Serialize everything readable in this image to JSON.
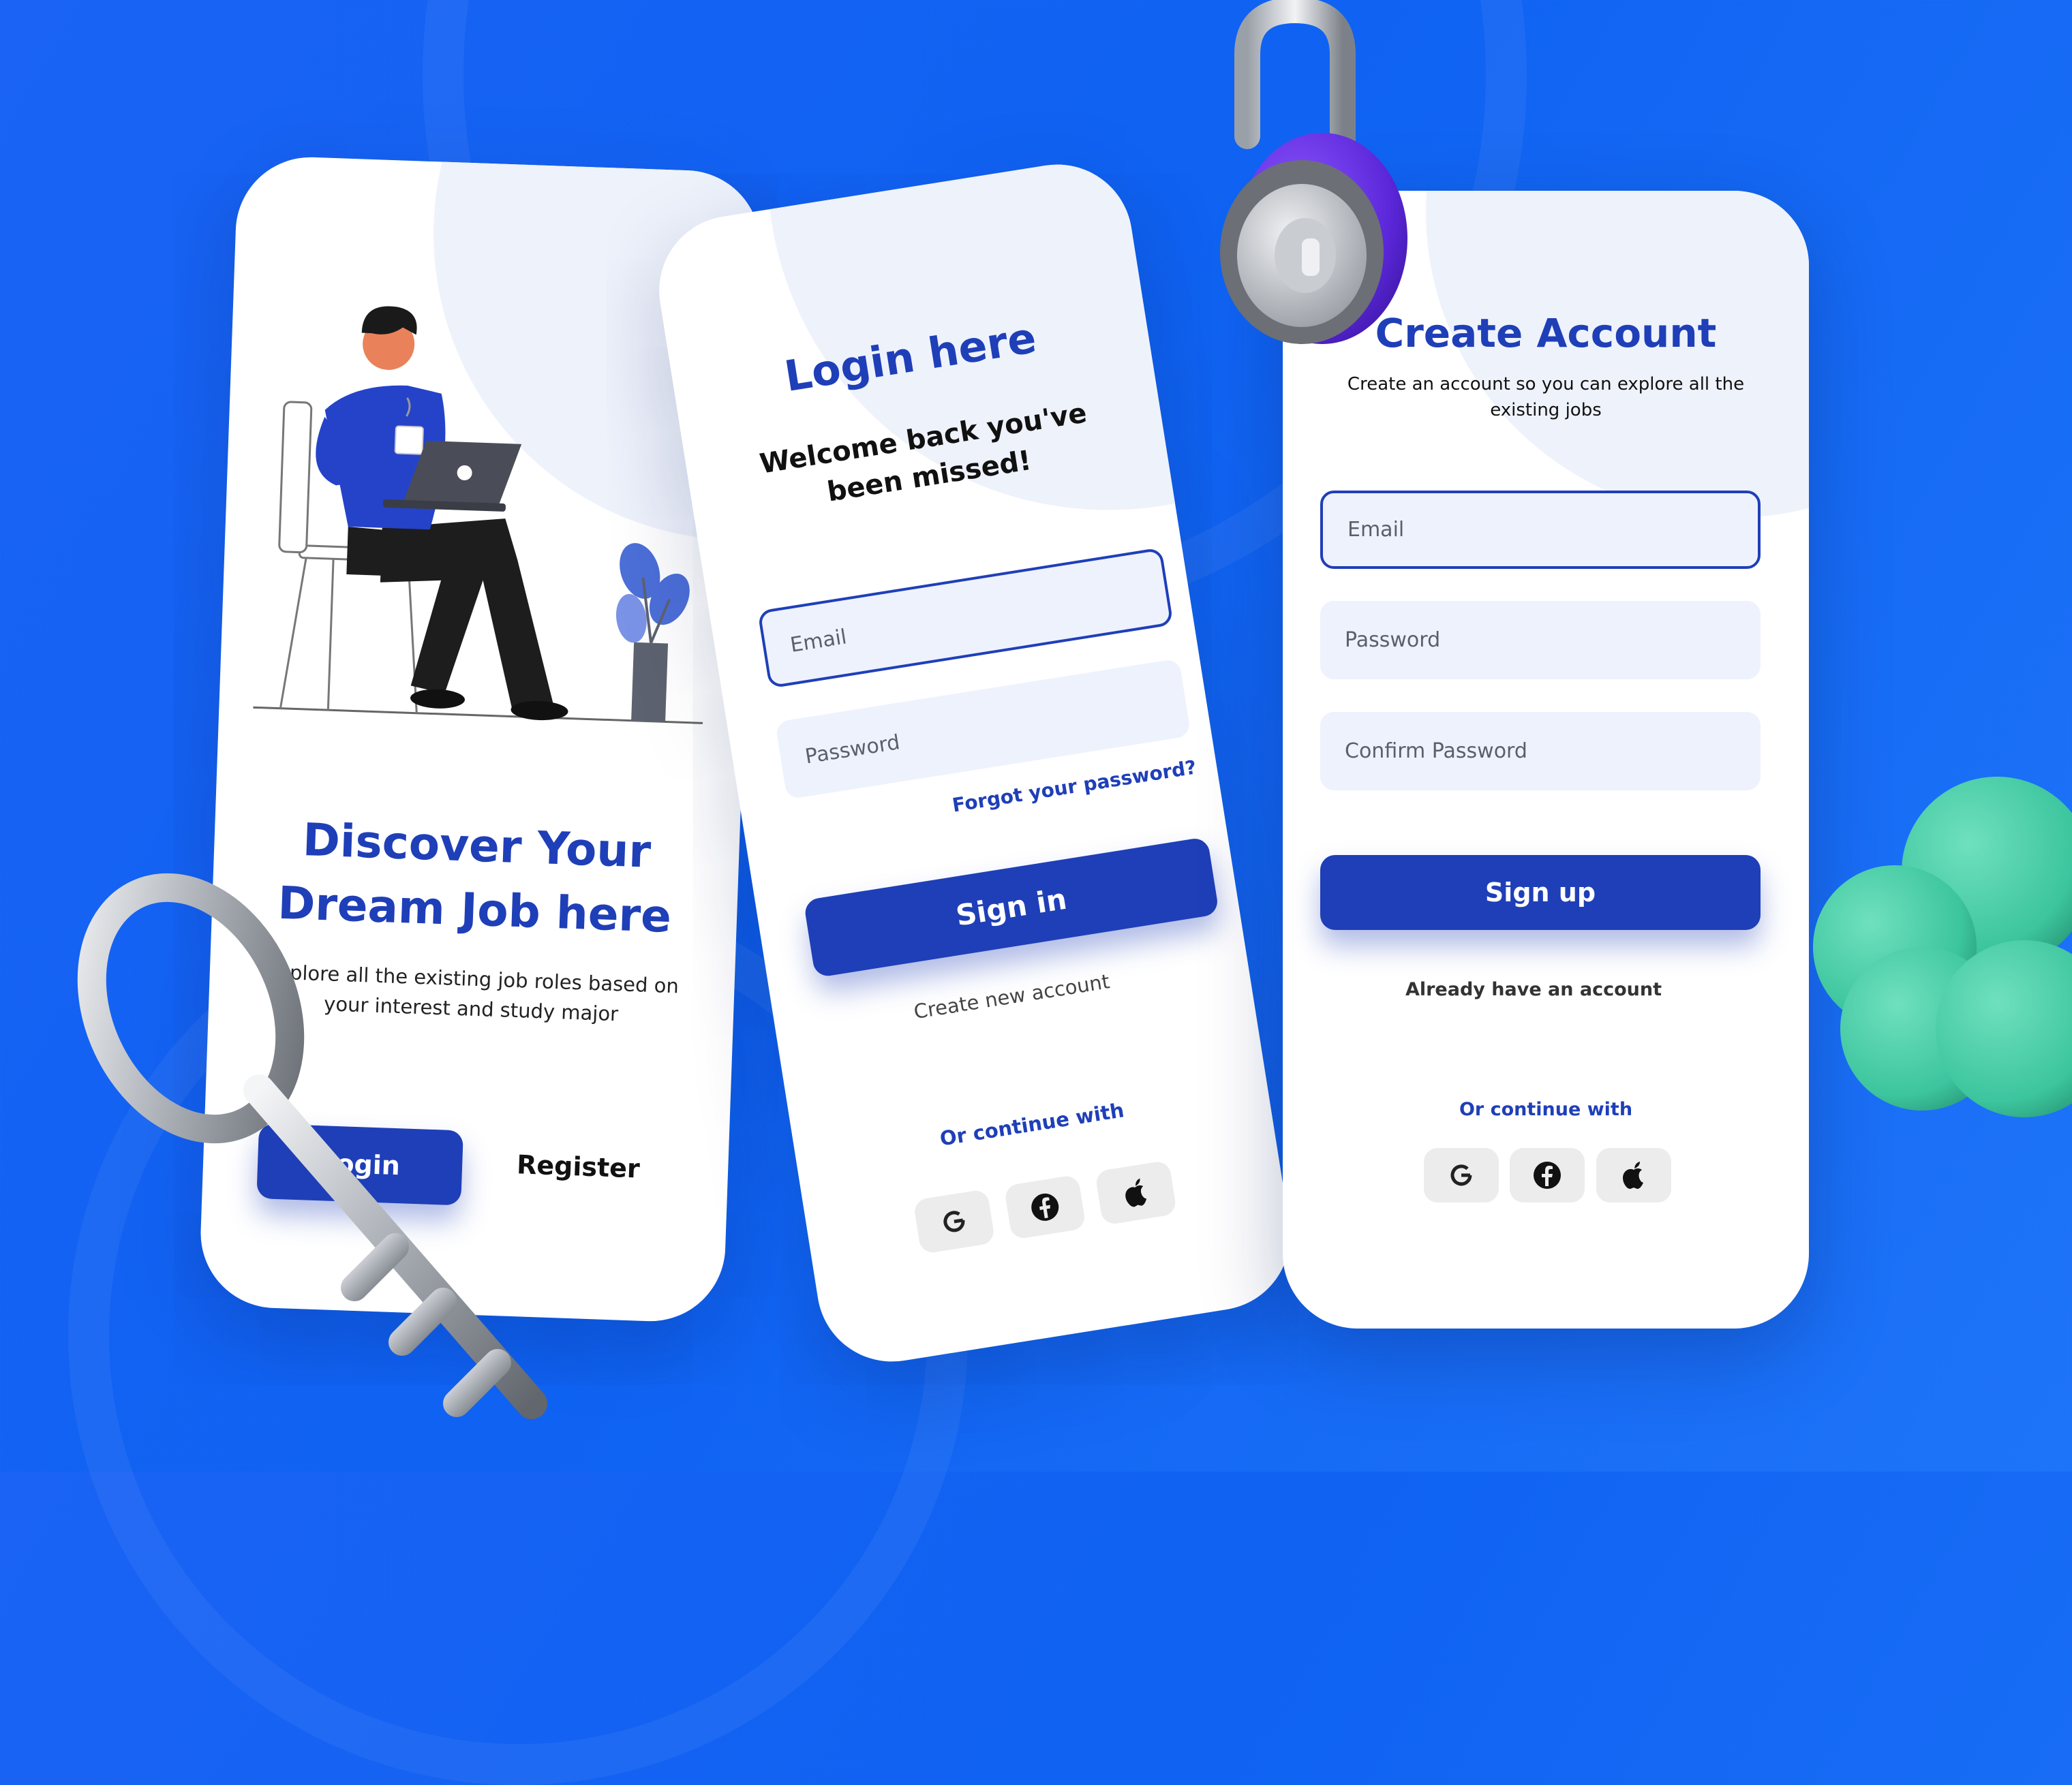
{
  "colors": {
    "background": "#1a63f4",
    "brand": "#1f3fb8",
    "field_bg": "#eef2fd",
    "social_bg": "#ececec",
    "cloud": "#3cc59e",
    "lock_body": "#6a2fe0"
  },
  "screen_onboarding": {
    "title_line1": "Discover Your",
    "title_line2": "Dream Job here",
    "subtitle_line1": "Explore all the existing job roles based on",
    "subtitle_line2": "your interest and study major",
    "login_label": "Login",
    "register_label": "Register",
    "illustration": "person-laptop-illustration"
  },
  "screen_login": {
    "title": "Login here",
    "welcome_line1": "Welcome back you've",
    "welcome_line2": "been missed!",
    "email_placeholder": "Email",
    "password_placeholder": "Password",
    "forgot_label": "Forgot your password?",
    "signin_label": "Sign in",
    "create_account_label": "Create new account",
    "continue_label": "Or continue with",
    "social": [
      "google-icon",
      "facebook-icon",
      "apple-icon"
    ]
  },
  "screen_signup": {
    "title": "Create Account",
    "subtitle_line1": "Create an account so you can explore all the",
    "subtitle_line2": "existing jobs",
    "email_placeholder": "Email",
    "password_placeholder": "Password",
    "confirm_placeholder": "Confirm Password",
    "signup_label": "Sign up",
    "have_account_label": "Already have an account",
    "continue_label": "Or continue with",
    "social": [
      "google-icon",
      "facebook-icon",
      "apple-icon"
    ]
  },
  "decorations": [
    "key-3d",
    "padlock-3d",
    "cloud-3d"
  ]
}
